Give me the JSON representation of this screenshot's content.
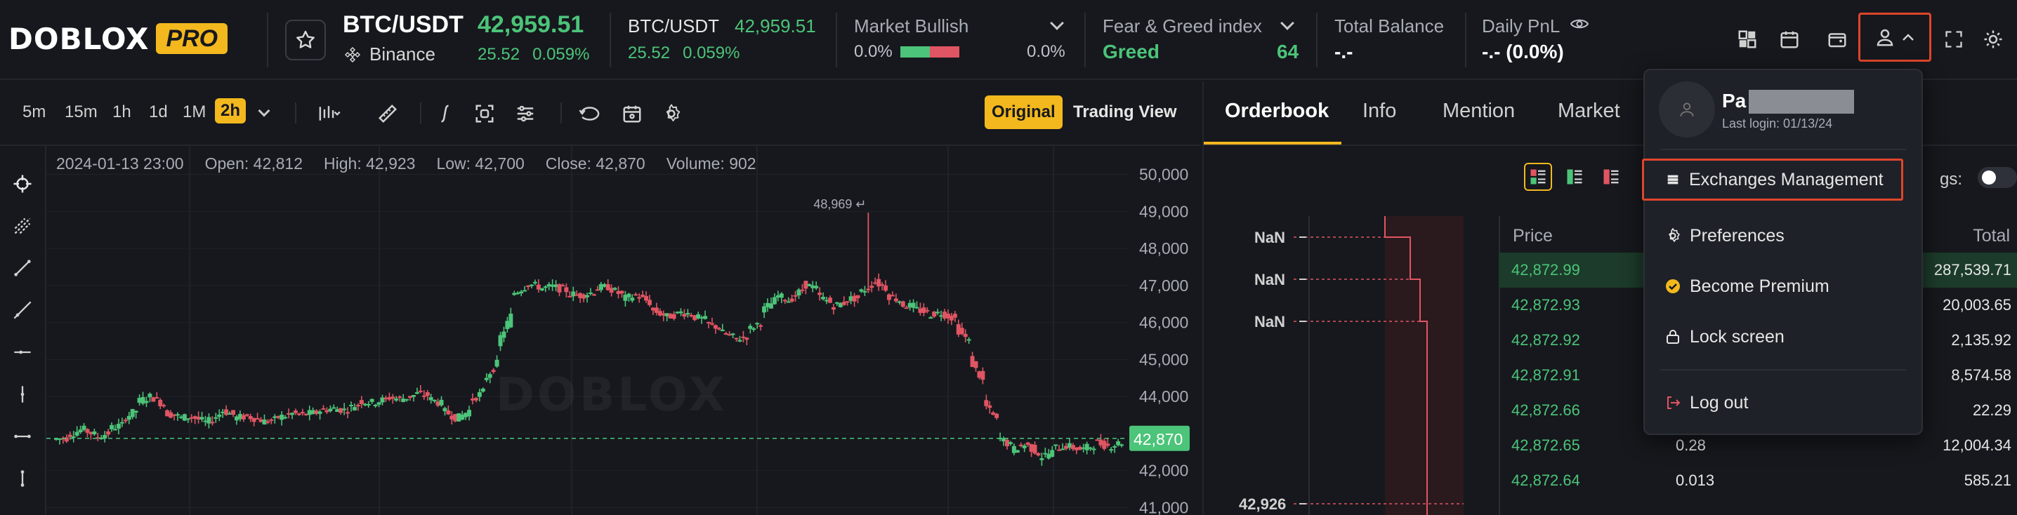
{
  "header": {
    "logo_text": "DOBLOX",
    "logo_badge": "PRO",
    "pair": "BTC/USDT",
    "price": "42,959.51",
    "exchange": "Binance",
    "change_abs": "25.52",
    "change_pct": "0.059%",
    "ticker2": {
      "pair": "BTC/USDT",
      "price": "42,959.51",
      "change_abs": "25.52",
      "change_pct": "0.059%"
    },
    "market": {
      "label": "Market Bullish",
      "left_pct": "0.0%",
      "right_pct": "0.0%"
    },
    "fear_greed": {
      "label": "Fear & Greed index",
      "state": "Greed",
      "value": "64"
    },
    "balance": {
      "label": "Total Balance",
      "value": "-.-"
    },
    "pnl": {
      "label": "Daily PnL",
      "value": "-.- (0.0%)"
    }
  },
  "toolbar": {
    "timeframes": [
      "5m",
      "15m",
      "1h",
      "1d",
      "1M",
      "2h"
    ],
    "active_timeframe": "2h",
    "original_label": "Original",
    "tradingview_label": "Trading View"
  },
  "chart_info": {
    "date": "2024-01-13 23:00",
    "open": "Open: 42,812",
    "high": "High: 42,923",
    "low": "Low: 42,700",
    "close": "Close: 42,870",
    "volume": "Volume: 902",
    "watermark": "DOBLOX",
    "peak_label": "48,969",
    "current_price_label": "42,870"
  },
  "chart_data": {
    "type": "candlestick",
    "ylim": [
      40800,
      50200
    ],
    "yticks": [
      "50,000",
      "49,000",
      "48,000",
      "47,000",
      "46,000",
      "45,000",
      "44,000",
      "43,000",
      "42,000",
      "41,000"
    ],
    "current_price": 42870,
    "peak": 48969,
    "close_path": [
      42900,
      43200,
      42850,
      43100,
      43300,
      43800,
      44100,
      43600,
      43400,
      43500,
      43200,
      43700,
      43400,
      43500,
      43300,
      43400,
      43550,
      43500,
      43600,
      43700,
      43600,
      43900,
      43800,
      44000,
      43900,
      44100,
      44000,
      43700,
      43300,
      43800,
      44300,
      45200,
      46700,
      47100,
      46900,
      47000,
      46800,
      46700,
      46900,
      47000,
      46600,
      46800,
      46400,
      46100,
      46300,
      46200,
      46000,
      45800,
      45500,
      45700,
      46200,
      46800,
      46500,
      47100,
      46800,
      46400,
      46600,
      46700,
      47200,
      46800,
      46500,
      46400,
      46200,
      46300,
      46000,
      45200,
      44000,
      43000,
      42500,
      42800,
      42300,
      42600,
      42700,
      42500,
      42800,
      42600,
      42870
    ]
  },
  "orderbook": {
    "tabs": [
      "Orderbook",
      "Info",
      "Mention",
      "Market"
    ],
    "settings_trunc": "gs:",
    "headers": {
      "price": "Price",
      "total": "Total"
    },
    "depth_labels": [
      "NaN",
      "NaN",
      "NaN",
      "42,926"
    ],
    "rows": [
      {
        "price": "42,872.99",
        "amount": "",
        "total": "287,539.71"
      },
      {
        "price": "42,872.93",
        "amount": "",
        "total": "20,003.65"
      },
      {
        "price": "42,872.92",
        "amount": "",
        "total": "2,135.92"
      },
      {
        "price": "42,872.91",
        "amount": "",
        "total": "8,574.58"
      },
      {
        "price": "42,872.66",
        "amount": "",
        "total": "22.29"
      },
      {
        "price": "42,872.65",
        "amount": "0.28",
        "total": "12,004.34"
      },
      {
        "price": "42,872.64",
        "amount": "0.013",
        "total": "585.21"
      }
    ]
  },
  "user_menu": {
    "name": "Pa",
    "last_login": "Last login: 01/13/24",
    "items": [
      "Exchanges Management",
      "Preferences",
      "Become Premium",
      "Lock screen",
      "Log out"
    ]
  },
  "colors": {
    "accent": "#f3b81e",
    "up": "#4cc479",
    "down": "#e05563",
    "highlight": "#e0452b"
  }
}
